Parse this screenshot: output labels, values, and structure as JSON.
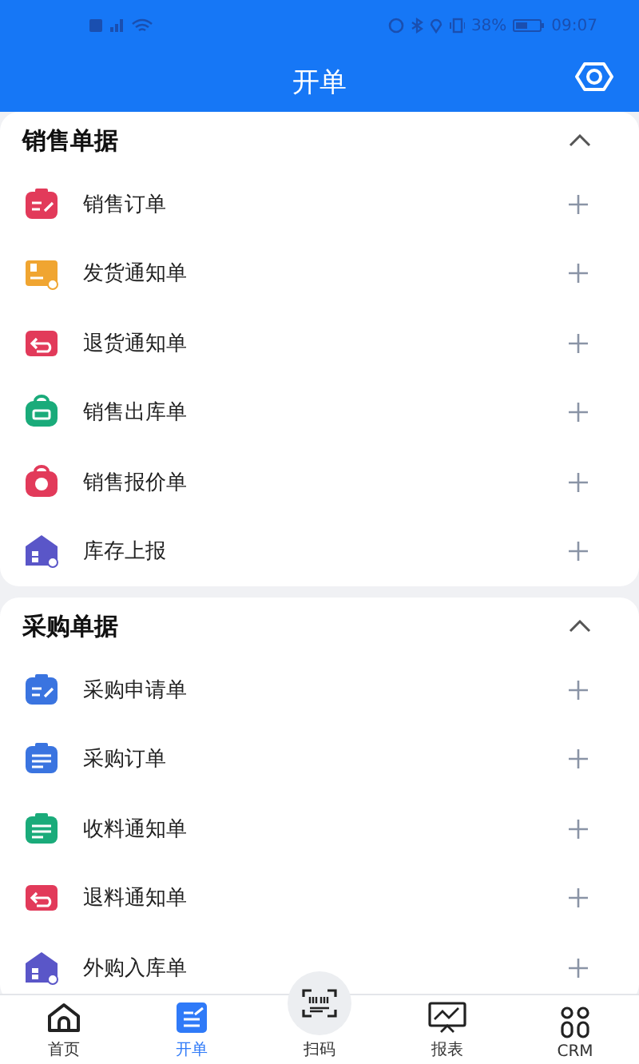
{
  "status_bar": {
    "battery": "38%",
    "time": "09:07"
  },
  "header": {
    "title": "开单"
  },
  "sections": [
    {
      "title": "销售单据",
      "expanded": true,
      "items": [
        {
          "label": "销售订单",
          "kind": "clipboard",
          "color": "#e23a5a"
        },
        {
          "label": "发货通知单",
          "kind": "box",
          "color": "#f0a531"
        },
        {
          "label": "退货通知单",
          "kind": "return",
          "color": "#e23a5a"
        },
        {
          "label": "销售出库单",
          "kind": "bag",
          "color": "#1aab7a"
        },
        {
          "label": "销售报价单",
          "kind": "coin",
          "color": "#e23a5a"
        },
        {
          "label": "库存上报",
          "kind": "house",
          "color": "#5a56c8"
        }
      ]
    },
    {
      "title": "采购单据",
      "expanded": true,
      "items": [
        {
          "label": "采购申请单",
          "kind": "clipboard",
          "color": "#3a74e0"
        },
        {
          "label": "采购订单",
          "kind": "list",
          "color": "#3a74e0"
        },
        {
          "label": "收料通知单",
          "kind": "list",
          "color": "#1aab7a"
        },
        {
          "label": "退料通知单",
          "kind": "return",
          "color": "#e23a5a"
        },
        {
          "label": "外购入库单",
          "kind": "house",
          "color": "#5a56c8"
        }
      ]
    }
  ],
  "tab_bar": [
    {
      "label": "首页",
      "kind": "home",
      "selected": false
    },
    {
      "label": "开单",
      "kind": "form",
      "selected": true
    },
    {
      "label": "扫码",
      "kind": "scan",
      "selected": false
    },
    {
      "label": "报表",
      "kind": "chart",
      "selected": false
    },
    {
      "label": "CRM",
      "kind": "crm",
      "selected": false
    }
  ]
}
